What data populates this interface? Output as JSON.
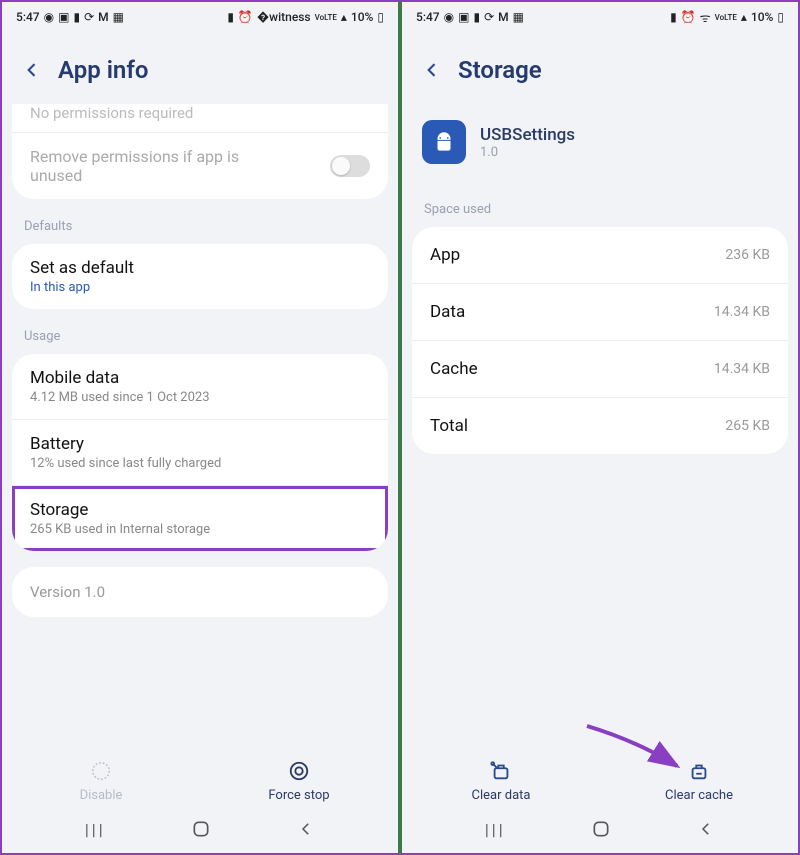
{
  "status": {
    "time": "5:47",
    "battery_pct": "10%"
  },
  "left": {
    "title": "App info",
    "truncated": "No permissions required",
    "remove_perm": "Remove permissions if app is unused",
    "section_defaults": "Defaults",
    "set_default_title": "Set as default",
    "set_default_sub": "In this app",
    "section_usage": "Usage",
    "mobile_title": "Mobile data",
    "mobile_sub": "4.12 MB used since 1 Oct 2023",
    "battery_title": "Battery",
    "battery_sub": "12% used since last fully charged",
    "storage_title": "Storage",
    "storage_sub": "265 KB used in Internal storage",
    "version": "Version 1.0",
    "disable": "Disable",
    "force_stop": "Force stop"
  },
  "right": {
    "title": "Storage",
    "app_name": "USBSettings",
    "app_version": "1.0",
    "section_space": "Space used",
    "rows": {
      "app_label": "App",
      "app_val": "236 KB",
      "data_label": "Data",
      "data_val": "14.34 KB",
      "cache_label": "Cache",
      "cache_val": "14.34 KB",
      "total_label": "Total",
      "total_val": "265 KB"
    },
    "clear_data": "Clear data",
    "clear_cache": "Clear cache"
  }
}
